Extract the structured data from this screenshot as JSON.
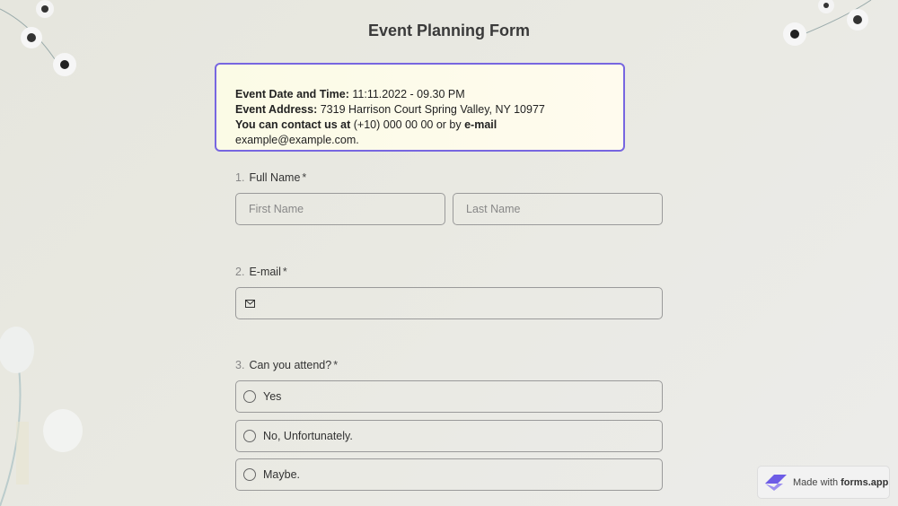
{
  "form": {
    "title": "Event Planning Form"
  },
  "info": {
    "date_label": "Event Date and Time:",
    "date_value": " 11:11.2022 - 09.30 PM",
    "address_label": "Event Address:",
    "address_value": " 7319 Harrison Court Spring Valley, NY 10977",
    "contact_label": "You can contact us at",
    "contact_phone": " (+10) 000 00 00 or by ",
    "email_label": "e-mail",
    "email_value": " example@example.com."
  },
  "questions": [
    {
      "number": "1.",
      "label": "Full Name",
      "required_mark": "*",
      "first_placeholder": "First Name",
      "last_placeholder": "Last Name"
    },
    {
      "number": "2.",
      "label": "E-mail",
      "required_mark": "*"
    },
    {
      "number": "3.",
      "label": "Can you attend?",
      "required_mark": "*",
      "options": [
        "Yes",
        "No, Unfortunately.",
        "Maybe."
      ]
    }
  ],
  "badge": {
    "prefix": "Made with",
    "brand": "forms.app"
  },
  "colors": {
    "accent_border": "#7766e0",
    "background": "#e8e8e0",
    "brand_logo": "#6d5ce6"
  }
}
